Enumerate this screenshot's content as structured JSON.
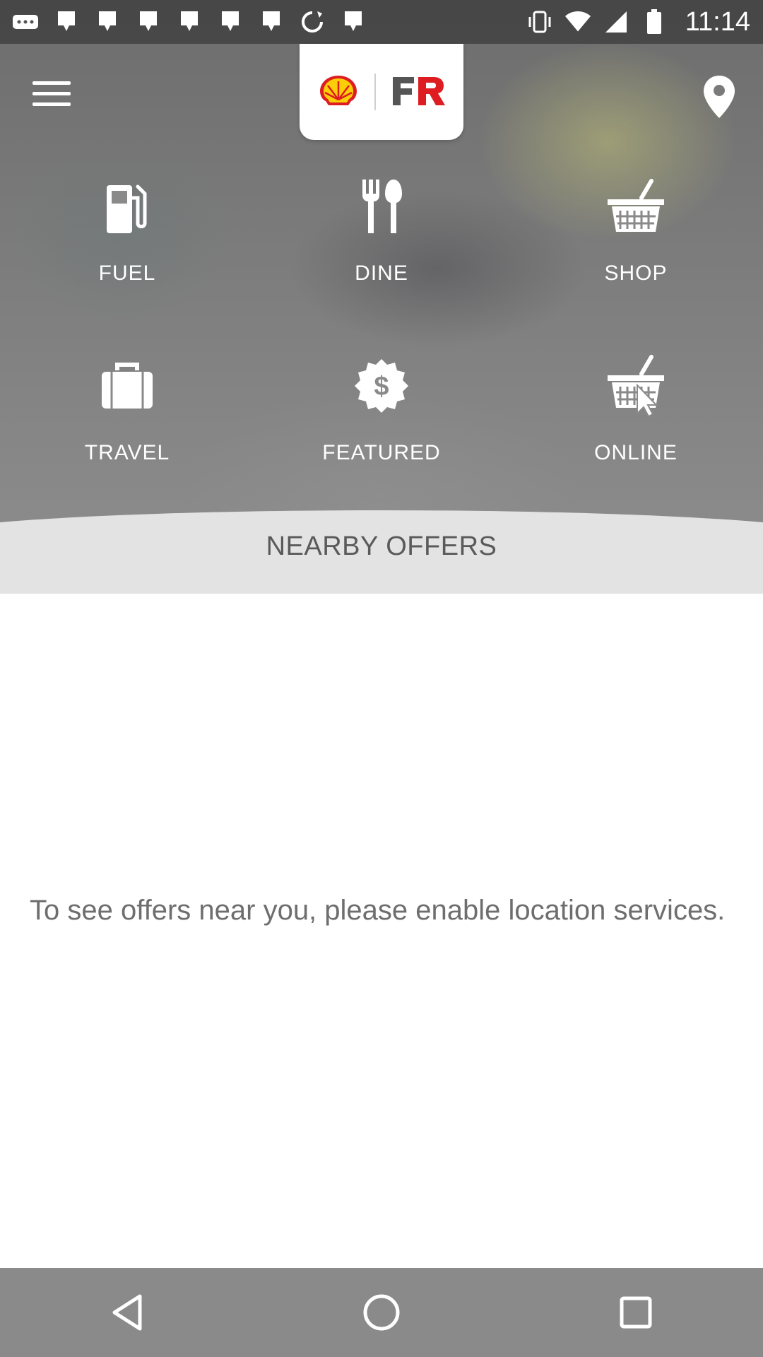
{
  "status_bar": {
    "time": "11:14",
    "left_icons": [
      "more-icon",
      "notification-icon",
      "notification-icon",
      "notification-icon",
      "notification-icon",
      "notification-icon",
      "notification-icon",
      "sync-icon",
      "notification-icon"
    ],
    "right_icons": [
      "vibrate-icon",
      "wifi-icon",
      "signal-icon",
      "battery-icon"
    ]
  },
  "header": {
    "menu_icon": "hamburger-menu-icon",
    "location_icon": "map-pin-icon",
    "logos": [
      "shell-logo",
      "fuel-rewards-logo"
    ]
  },
  "categories": [
    {
      "label": "FUEL",
      "icon": "fuel-pump-icon"
    },
    {
      "label": "DINE",
      "icon": "fork-spoon-icon"
    },
    {
      "label": "SHOP",
      "icon": "basket-icon"
    },
    {
      "label": "TRAVEL",
      "icon": "suitcase-icon"
    },
    {
      "label": "FEATURED",
      "icon": "dollar-badge-icon"
    },
    {
      "label": "ONLINE",
      "icon": "online-basket-icon"
    }
  ],
  "nearby": {
    "title": "NEARBY OFFERS",
    "message": "To see offers near you, please enable location services."
  },
  "nav_bar": {
    "buttons": [
      "back-icon",
      "home-icon",
      "recents-icon"
    ]
  },
  "colors": {
    "shell_red": "#dd1d21",
    "shell_yellow": "#fbce07",
    "fr_dark": "#555555",
    "nav_bg": "#8a8a8a",
    "nearby_bg": "#e3e3e3"
  }
}
